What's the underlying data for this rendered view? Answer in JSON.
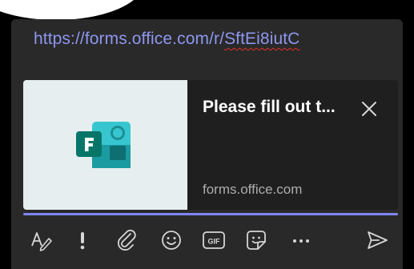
{
  "compose": {
    "url_prefix": "https://forms.office.com/r/",
    "url_misspelled": "SftEi8iutC"
  },
  "link_card": {
    "title": "Please fill out t...",
    "domain": "forms.office.com",
    "thumbnail_icon": "microsoft-forms-logo"
  },
  "toolbar": {
    "buttons": [
      {
        "name": "format-icon"
      },
      {
        "name": "important-icon"
      },
      {
        "name": "attach-icon"
      },
      {
        "name": "emoji-icon"
      },
      {
        "name": "gif-icon",
        "label": "GIF"
      },
      {
        "name": "sticker-icon"
      },
      {
        "name": "more-options-icon",
        "label": "···"
      },
      {
        "name": "send-icon"
      }
    ]
  },
  "colors": {
    "background": "#000000",
    "compose_bg": "#292929",
    "card_bg": "#1f1f1f",
    "link": "#8e96ee",
    "accent": "#7f85f5",
    "forms_green": "#0b7a75"
  }
}
